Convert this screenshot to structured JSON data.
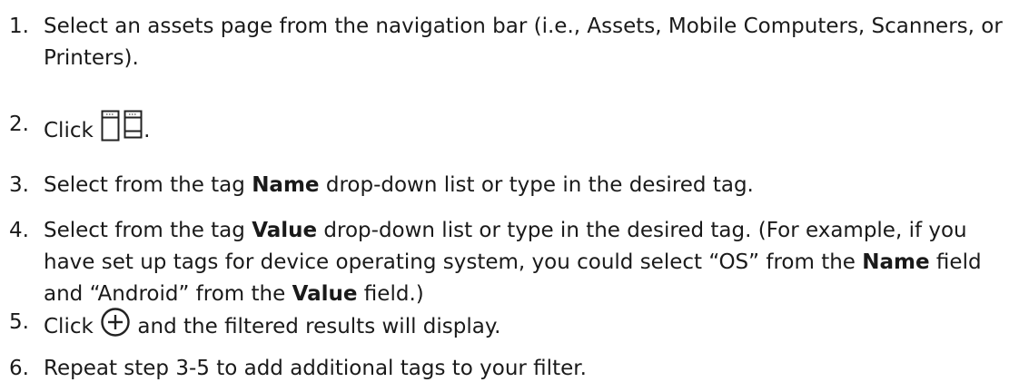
{
  "steps": [
    {
      "number": "1.",
      "parts": [
        "Select an assets page from the navigation bar (i.e., Assets, Mobile Computers, Scanners, or Printers)."
      ]
    },
    {
      "number": "2.",
      "before": "Click",
      "after": ".",
      "icon": "column-view-icon"
    },
    {
      "number": "3.",
      "before": "Select from the tag ",
      "bold": "Name",
      "after": " drop-down list or type in the desired tag."
    },
    {
      "number": "4.",
      "before": "Select from the tag ",
      "bold1": "Value",
      "middle1": " drop-down list or type in the desired tag. (For example, if you have set up tags for device operating system, you could select “OS” from the ",
      "bold2": "Name",
      "middle2": " field and “Android” from the ",
      "bold3": "Value",
      "after": " field.)"
    },
    {
      "number": "5.",
      "before": "Click",
      "after": " and the filtered results will display.",
      "icon": "add-circle-icon"
    },
    {
      "number": "6.",
      "text": "Repeat step 3-5 to add additional tags to your filter."
    }
  ]
}
